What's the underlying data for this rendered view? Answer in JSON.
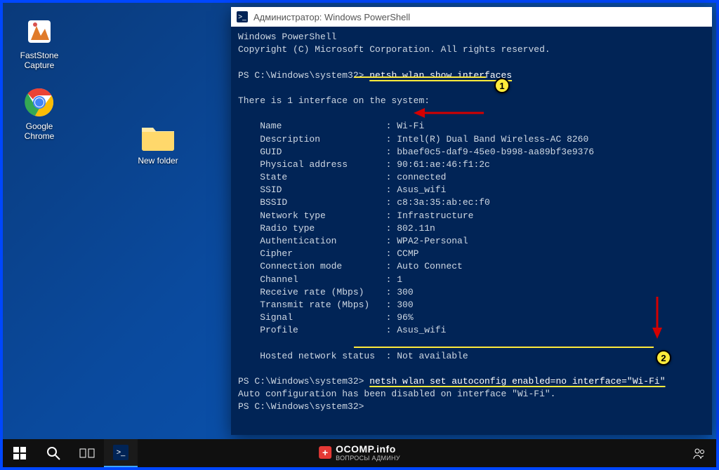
{
  "window": {
    "title": "Администратор: Windows PowerShell"
  },
  "desktop_icons": {
    "faststone": "FastStone Capture",
    "chrome": "Google Chrome",
    "newfolder": "New folder"
  },
  "terminal": {
    "header1": "Windows PowerShell",
    "header2": "Copyright (C) Microsoft Corporation. All rights reserved.",
    "prompt": "PS C:\\Windows\\system32>",
    "cmd1": "netsh wlan show interfaces",
    "intro": "There is 1 interface on the system:",
    "rows": {
      "Name": "Wi-Fi",
      "Description": "Intel(R) Dual Band Wireless-AC 8260",
      "GUID": "bbaef0c5-daf9-45e0-b998-aa89bf3e9376",
      "Physical address": "90:61:ae:46:f1:2c",
      "State": "connected",
      "SSID": "Asus_wifi",
      "BSSID": "c8:3a:35:ab:ec:f0",
      "Network type": "Infrastructure",
      "Radio type": "802.11n",
      "Authentication": "WPA2-Personal",
      "Cipher": "CCMP",
      "Connection mode": "Auto Connect",
      "Channel": "1",
      "Receive rate (Mbps)": "300",
      "Transmit rate (Mbps)": "300",
      "Signal": "96%",
      "Profile": "Asus_wifi"
    },
    "hosted_label": "Hosted network status",
    "hosted_value": "Not available",
    "cmd2": "netsh wlan set autoconfig enabled=no interface=\"Wi-Fi\"",
    "response": "Auto configuration has been disabled on interface \"Wi-Fi\"."
  },
  "callouts": {
    "one": "1",
    "two": "2"
  },
  "watermark": {
    "brand": "OCOMP.info",
    "sub": "ВОПРОСЫ АДМИНУ"
  }
}
